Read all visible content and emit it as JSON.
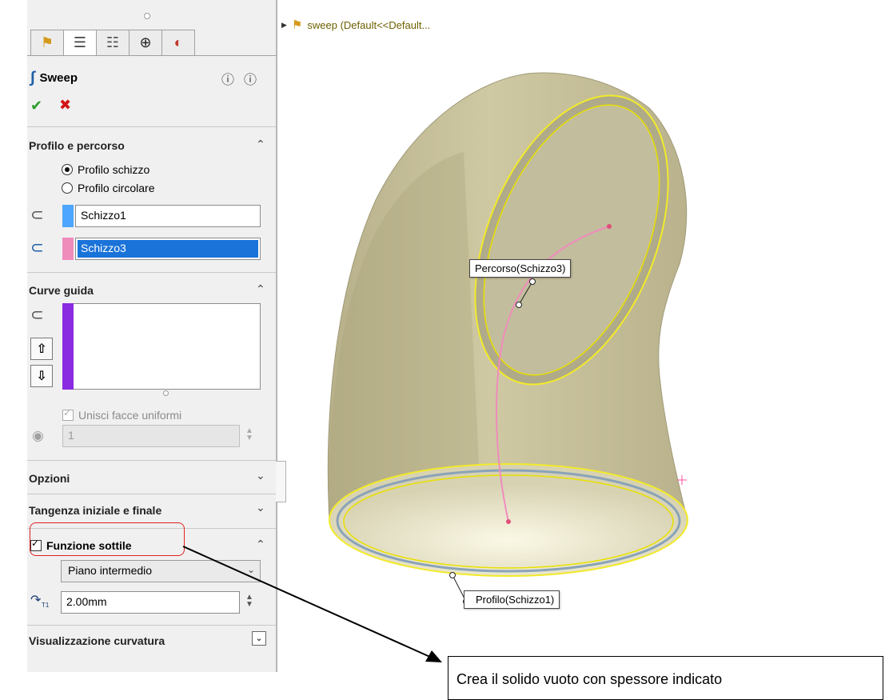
{
  "feature_manager": {
    "tabs": [
      {
        "icon": "part-icon",
        "glyph": "⚑"
      },
      {
        "icon": "property-manager-icon",
        "glyph": "☰"
      },
      {
        "icon": "config-manager-icon",
        "glyph": "☷"
      },
      {
        "icon": "dimxpert-icon",
        "glyph": "⊕"
      },
      {
        "icon": "appearance-icon",
        "glyph": "◐"
      }
    ],
    "title": "Sweep",
    "help_icons": [
      "❓",
      "ⓘ"
    ]
  },
  "sections": {
    "profile_path": {
      "title": "Profilo e percorso",
      "radio_sketch": "Profilo schizzo",
      "radio_circular": "Profilo circolare",
      "profile_value": "Schizzo1",
      "path_value": "Schizzo3",
      "profile_color": "#4da6ff",
      "path_color": "#f08cbc"
    },
    "guide_curves": {
      "title": "Curve guida",
      "merge_faces": "Unisci facce uniformi",
      "count_value": "1",
      "list_color": "#8a2be2"
    },
    "options": {
      "title": "Opzioni"
    },
    "tangency": {
      "title": "Tangenza iniziale e finale"
    },
    "thin_feature": {
      "title": "Funzione sottile",
      "type": "Piano intermedio",
      "thickness": "2.00mm",
      "icon_text": "T1"
    },
    "curvature": {
      "title": "Visualizzazione curvatura"
    }
  },
  "viewport": {
    "tree_label": "sweep  (Default<<Default...",
    "path_label": "Percorso(Schizzo3)",
    "profile_label": "Profilo(Schizzo1)",
    "model_color": "#c9c39a",
    "edge_color": "#f2ea2a",
    "path_sketch_color": "#f08cbc"
  },
  "annotation": {
    "callout_text": "Crea il solido vuoto con spessore indicato",
    "highlight_color": "#e02020"
  }
}
